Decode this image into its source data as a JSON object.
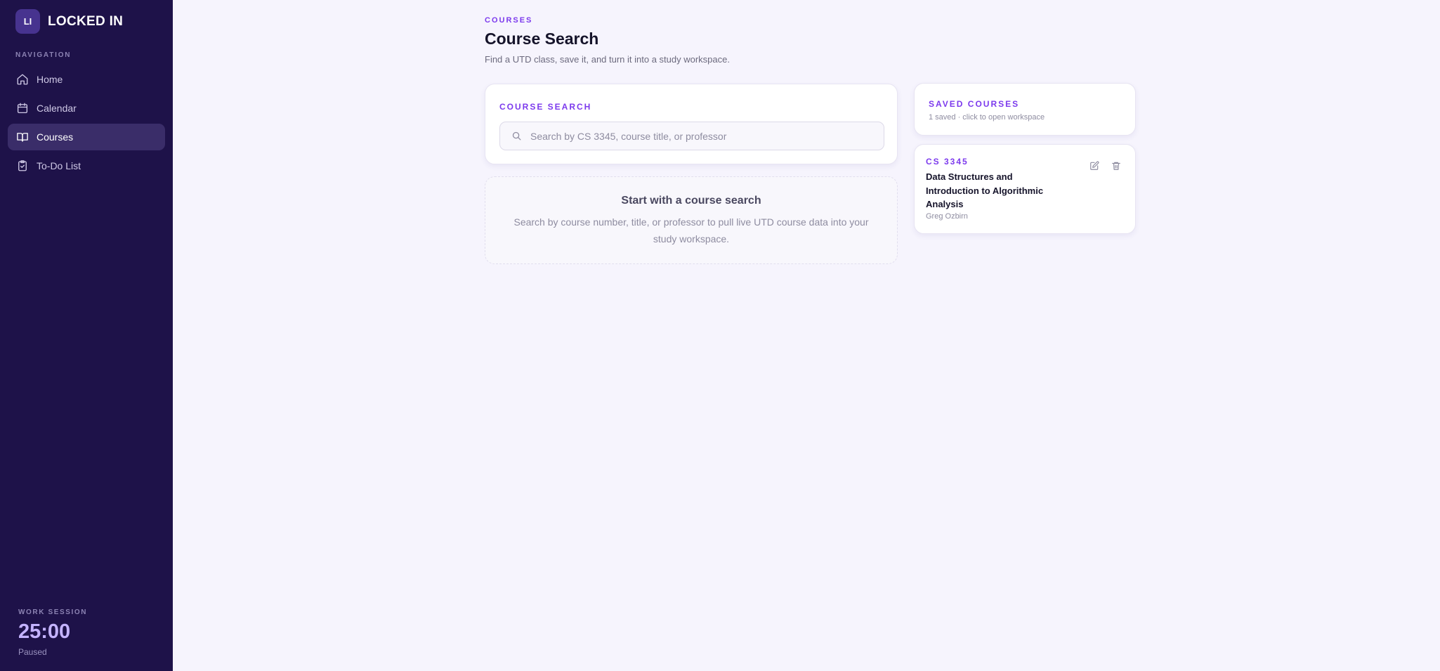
{
  "brand": {
    "initials": "LI",
    "name": "LOCKED IN"
  },
  "sidebar": {
    "heading": "NAVIGATION",
    "items": [
      {
        "label": "Home",
        "icon": "home-icon",
        "active": false
      },
      {
        "label": "Calendar",
        "icon": "calendar-icon",
        "active": false
      },
      {
        "label": "Courses",
        "icon": "book-icon",
        "active": true
      },
      {
        "label": "To-Do List",
        "icon": "clipboard-check-icon",
        "active": false
      }
    ],
    "session": {
      "heading": "WORK SESSION",
      "time": "25:00",
      "status": "Paused"
    }
  },
  "header": {
    "eyebrow": "COURSES",
    "title": "Course Search",
    "subtitle": "Find a UTD class, save it, and turn it into a study workspace."
  },
  "search": {
    "label": "COURSE SEARCH",
    "value": "",
    "placeholder": "Search by CS 3345, course title, or professor"
  },
  "empty_state": {
    "title": "Start with a course search",
    "description": "Search by course number, title, or professor to pull live UTD course data into your study workspace."
  },
  "saved": {
    "title": "SAVED COURSES",
    "count": "1 saved · click to open workspace",
    "courses": [
      {
        "code": "CS 3345",
        "title": "Data Structures and Introduction to Algorithmic Analysis",
        "professor": "Greg Ozbirn"
      }
    ]
  },
  "colors": {
    "sidebar_bg": "#1e1249",
    "accent": "#7c3aed",
    "page_bg": "#f6f4fd",
    "timer": "#c4b3ff"
  }
}
